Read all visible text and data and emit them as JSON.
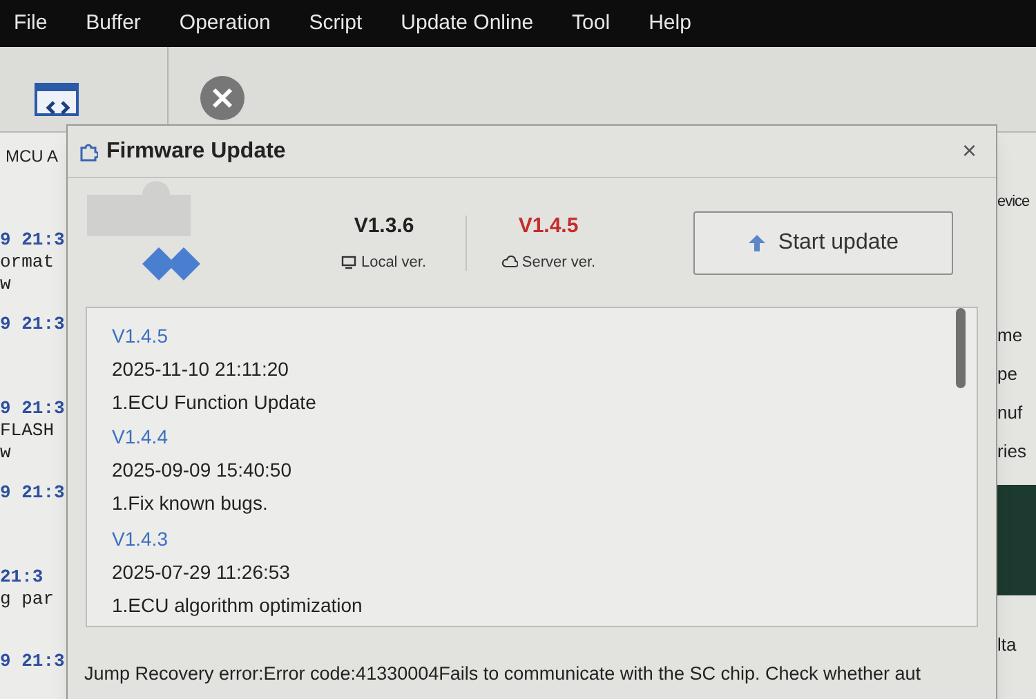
{
  "menu": [
    "File",
    "Buffer",
    "Operation",
    "Script",
    "Update Online",
    "Tool",
    "Help"
  ],
  "toolbar": {
    "mcu_label": "MCU A"
  },
  "log": [
    {
      "time": "9 21:3",
      "lines": [
        "ormat",
        "w"
      ]
    },
    {
      "time": "9 21:3"
    },
    {
      "time": "9 21:3",
      "lines": [
        "FLASH",
        "w"
      ]
    },
    {
      "time": "9 21:3"
    },
    {
      "time": "21:3",
      "lines": [
        "g par"
      ]
    },
    {
      "time": "9 21:3"
    }
  ],
  "right_panel": {
    "top": "evice",
    "fields": [
      "me",
      "pe",
      "nuf",
      "ries"
    ],
    "bottom": "lta"
  },
  "dialog": {
    "title": "Firmware Update",
    "close": "×",
    "local": {
      "version": "V1.3.6",
      "label": "Local ver."
    },
    "server": {
      "version": "V1.4.5",
      "label": "Server ver."
    },
    "button": "Start update",
    "releases": [
      {
        "version": "V1.4.5",
        "date": "2025-11-10 21:11:20",
        "note": "1.ECU Function Update"
      },
      {
        "version": "V1.4.4",
        "date": "2025-09-09 15:40:50",
        "note": "1.Fix known bugs."
      },
      {
        "version": "V1.4.3",
        "date": "2025-07-29 11:26:53",
        "note": "1.ECU algorithm optimization"
      }
    ],
    "status": "Jump Recovery error:Error code:41330004Fails to communicate with the SC chip. Check whether aut"
  }
}
